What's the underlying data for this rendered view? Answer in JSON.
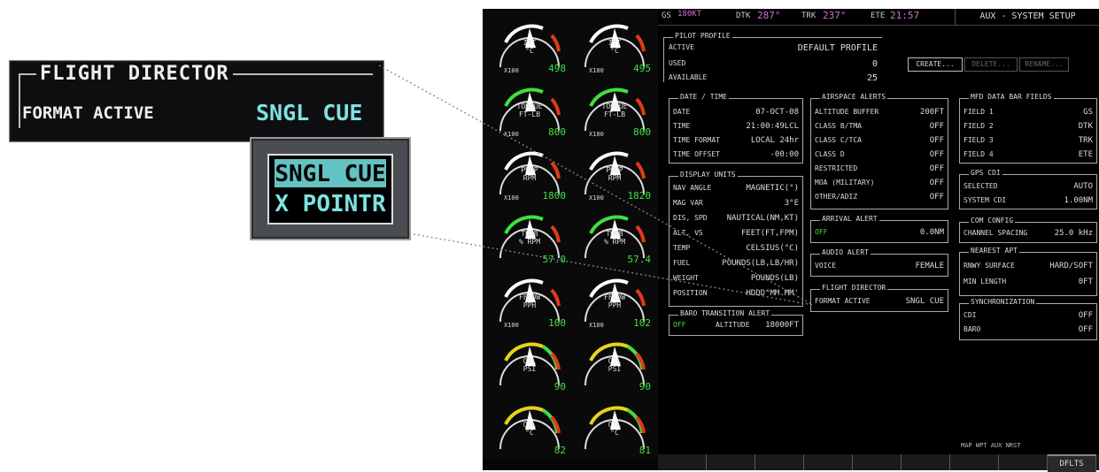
{
  "callout": {
    "title": "FLIGHT DIRECTOR",
    "label": "FORMAT ACTIVE",
    "value": "SNGL CUE",
    "options": [
      "SNGL CUE",
      "X POINTR"
    ]
  },
  "gauges": [
    {
      "label": "ITT\n°C",
      "scale": "X100",
      "value": "498"
    },
    {
      "label": "ITT\n°C",
      "scale": "X100",
      "value": "495"
    },
    {
      "label": "TORQUE\nFT-LB",
      "scale": "X100",
      "value": "800"
    },
    {
      "label": "TORQUE\nFT-LB",
      "scale": "X100",
      "value": "800"
    },
    {
      "label": "PROP\nRPM",
      "scale": "X100",
      "value": "1800"
    },
    {
      "label": "PROP\nRPM",
      "scale": "X100",
      "value": "1820"
    },
    {
      "label": "TURB\n% RPM",
      "scale": "",
      "value": "57.0"
    },
    {
      "label": "TURB\n% RPM",
      "scale": "",
      "value": "57.4"
    },
    {
      "label": "FFLOW\nPPH",
      "scale": "X100",
      "value": "100"
    },
    {
      "label": "FFLOW\nPPH",
      "scale": "X100",
      "value": "102"
    },
    {
      "label": "OIL\nPSI",
      "scale": "",
      "value": "90"
    },
    {
      "label": "OIL\nPSI",
      "scale": "",
      "value": "90"
    },
    {
      "label": "OIL\n°C",
      "scale": "",
      "value": "82"
    },
    {
      "label": "OIL\n°C",
      "scale": "",
      "value": "81"
    }
  ],
  "topbar": {
    "gs_label": "GS",
    "gs_value": "180KT",
    "dtk_label": "DTK",
    "dtk_value": "287°",
    "trk_label": "TRK",
    "trk_value": "237°",
    "ete_label": "ETE",
    "ete_value": "21:57",
    "page_title": "AUX - SYSTEM SETUP"
  },
  "pilot_profile": {
    "title": "PILOT PROFILE",
    "active_label": "ACTIVE",
    "active_value": "DEFAULT PROFILE",
    "used_label": "USED",
    "used_value": "0",
    "available_label": "AVAILABLE",
    "available_value": "25",
    "create": "CREATE...",
    "delete": "DELETE...",
    "rename": "RENAME..."
  },
  "date_time": {
    "title": "DATE / TIME",
    "rows": [
      {
        "k": "DATE",
        "v": "07-OCT-08"
      },
      {
        "k": "TIME",
        "v": "21:00:49LCL"
      },
      {
        "k": "TIME FORMAT",
        "v": "LOCAL 24hr"
      },
      {
        "k": "TIME OFFSET",
        "v": "-00:00"
      }
    ]
  },
  "display_units": {
    "title": "DISPLAY UNITS",
    "rows": [
      {
        "k": "NAV ANGLE",
        "v": "MAGNETIC(°)"
      },
      {
        "k": "MAG VAR",
        "v": "3°E"
      },
      {
        "k": "DIS, SPD",
        "v": "NAUTICAL(NM,KT)"
      },
      {
        "k": "ALT, VS",
        "v": "FEET(FT,FPM)"
      },
      {
        "k": "TEMP",
        "v": "CELSIUS(°C)"
      },
      {
        "k": "FUEL",
        "v": "POUNDS(LB,LB/HR)"
      },
      {
        "k": "WEIGHT",
        "v": "POUNDS(LB)"
      },
      {
        "k": "POSITION",
        "v": "HDDD°MM.MM'"
      }
    ]
  },
  "baro": {
    "title": "BARO TRANSITION ALERT",
    "state": "OFF",
    "alt_label": "ALTITUDE",
    "alt_value": "18000FT"
  },
  "airspace": {
    "title": "AIRSPACE ALERTS",
    "rows": [
      {
        "k": "ALTITUDE BUFFER",
        "v": "200FT"
      },
      {
        "k": "CLASS B/TMA",
        "v": "OFF"
      },
      {
        "k": "CLASS C/TCA",
        "v": "OFF"
      },
      {
        "k": "CLASS D",
        "v": "OFF"
      },
      {
        "k": "RESTRICTED",
        "v": "OFF"
      },
      {
        "k": "MOA (MILITARY)",
        "v": "OFF"
      },
      {
        "k": "OTHER/ADIZ",
        "v": "OFF"
      }
    ]
  },
  "arrival": {
    "title": "ARRIVAL ALERT",
    "state": "OFF",
    "value": "0.0NM"
  },
  "audio": {
    "title": "AUDIO ALERT",
    "label": "VOICE",
    "value": "FEMALE"
  },
  "flight_director": {
    "title": "FLIGHT DIRECTOR",
    "label": "FORMAT ACTIVE",
    "value": "SNGL CUE"
  },
  "mfd_fields": {
    "title": "MFD DATA BAR FIELDS",
    "rows": [
      {
        "k": "FIELD 1",
        "v": "GS"
      },
      {
        "k": "FIELD 2",
        "v": "DTK"
      },
      {
        "k": "FIELD 3",
        "v": "TRK"
      },
      {
        "k": "FIELD 4",
        "v": "ETE"
      }
    ]
  },
  "gps_cdi": {
    "title": "GPS CDI",
    "rows": [
      {
        "k": "SELECTED",
        "v": "AUTO"
      },
      {
        "k": "SYSTEM CDI",
        "v": "1.00NM"
      }
    ]
  },
  "com_config": {
    "title": "COM CONFIG",
    "label": "CHANNEL SPACING",
    "value": "25.0 kHz"
  },
  "nearest_apt": {
    "title": "NEAREST APT",
    "rows": [
      {
        "k": "RNWY SURFACE",
        "v": "HARD/SOFT"
      },
      {
        "k": "MIN LENGTH",
        "v": "0FT"
      }
    ]
  },
  "sync": {
    "title": "SYNCHRONIZATION",
    "rows": [
      {
        "k": "CDI",
        "v": "OFF"
      },
      {
        "k": "BARO",
        "v": "OFF"
      }
    ]
  },
  "page_indicator": "MAP WPT AUX NRST",
  "softkeys": [
    "",
    "",
    "",
    "",
    "",
    "",
    "",
    "",
    "DFLTS"
  ]
}
